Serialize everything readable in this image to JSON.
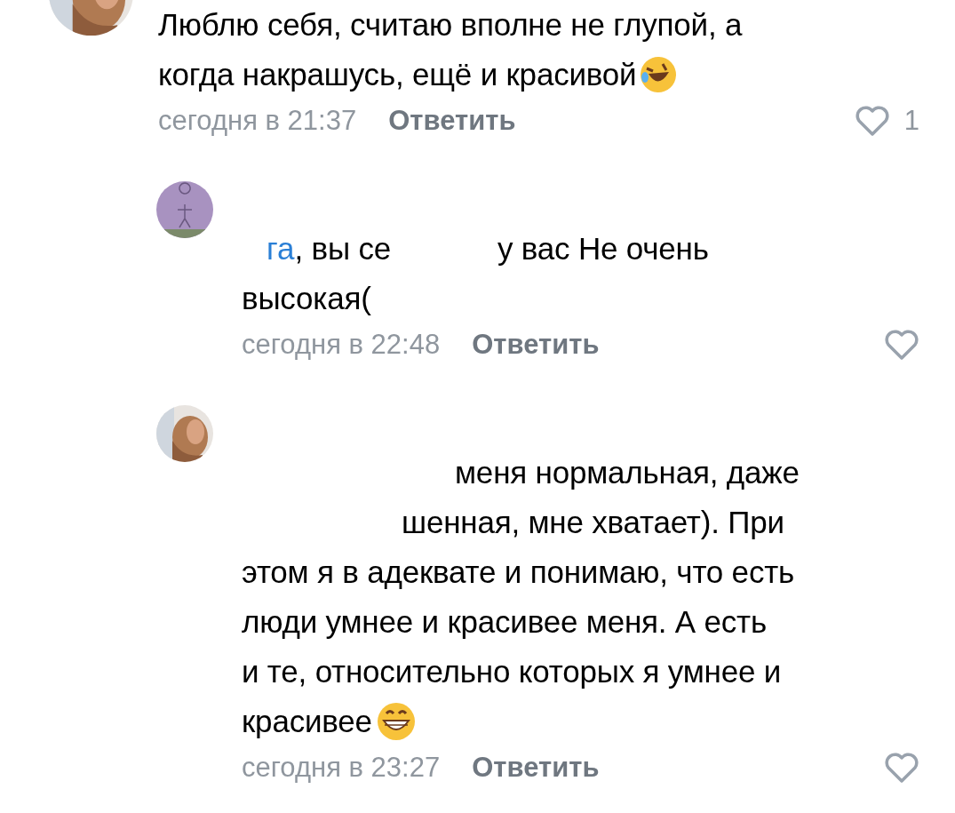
{
  "comments": [
    {
      "reply": false,
      "avatar": {
        "kind": "picture"
      },
      "lines": [
        [
          {
            "kind": "text",
            "text": "Люблю себя, считаю вполне не глупой, а"
          }
        ],
        [
          {
            "kind": "text",
            "text": "когда накрашусь, ещё и красивой"
          },
          {
            "kind": "laughing_emoji"
          }
        ]
      ],
      "time": "сегодня в 21:37",
      "reply_label": "Ответить",
      "likes": "1"
    },
    {
      "reply": true,
      "avatar": {
        "kind": "drawing"
      },
      "lines": [
        [
          {
            "kind": "mention",
            "text": "га"
          },
          {
            "kind": "text",
            "text": ", вы се"
          },
          {
            "kind": "gap"
          },
          {
            "kind": "gap"
          },
          {
            "kind": "text",
            "text": "у вас Не очень"
          }
        ],
        [
          {
            "kind": "text",
            "text": "высокая("
          }
        ]
      ],
      "time": "сегодня в 22:48",
      "reply_label": "Ответить"
    },
    {
      "reply": true,
      "avatar": {
        "kind": "picture"
      },
      "lines": [
        [
          {
            "kind": "gap"
          },
          {
            "kind": "gap"
          },
          {
            "kind": "gap"
          },
          {
            "kind": "gap"
          },
          {
            "kind": "text",
            "text": "меня нормальная, даже"
          }
        ],
        [
          {
            "kind": "gap"
          },
          {
            "kind": "gap"
          },
          {
            "kind": "gap"
          },
          {
            "kind": "text",
            "text": "шенная, мне хватает). При"
          }
        ],
        [
          {
            "kind": "text",
            "text": "этом я  в адеквате и понимаю, что есть"
          }
        ],
        [
          {
            "kind": "text",
            "text": "люди умнее и красивее меня. А есть"
          }
        ],
        [
          {
            "kind": "text",
            "text": "и те, относительно которых я умнее и"
          }
        ],
        [
          {
            "kind": "text",
            "text": "красивее"
          },
          {
            "kind": "grinning_emoji"
          }
        ]
      ],
      "time": "сегодня в 23:27",
      "reply_label": "Ответить"
    }
  ]
}
